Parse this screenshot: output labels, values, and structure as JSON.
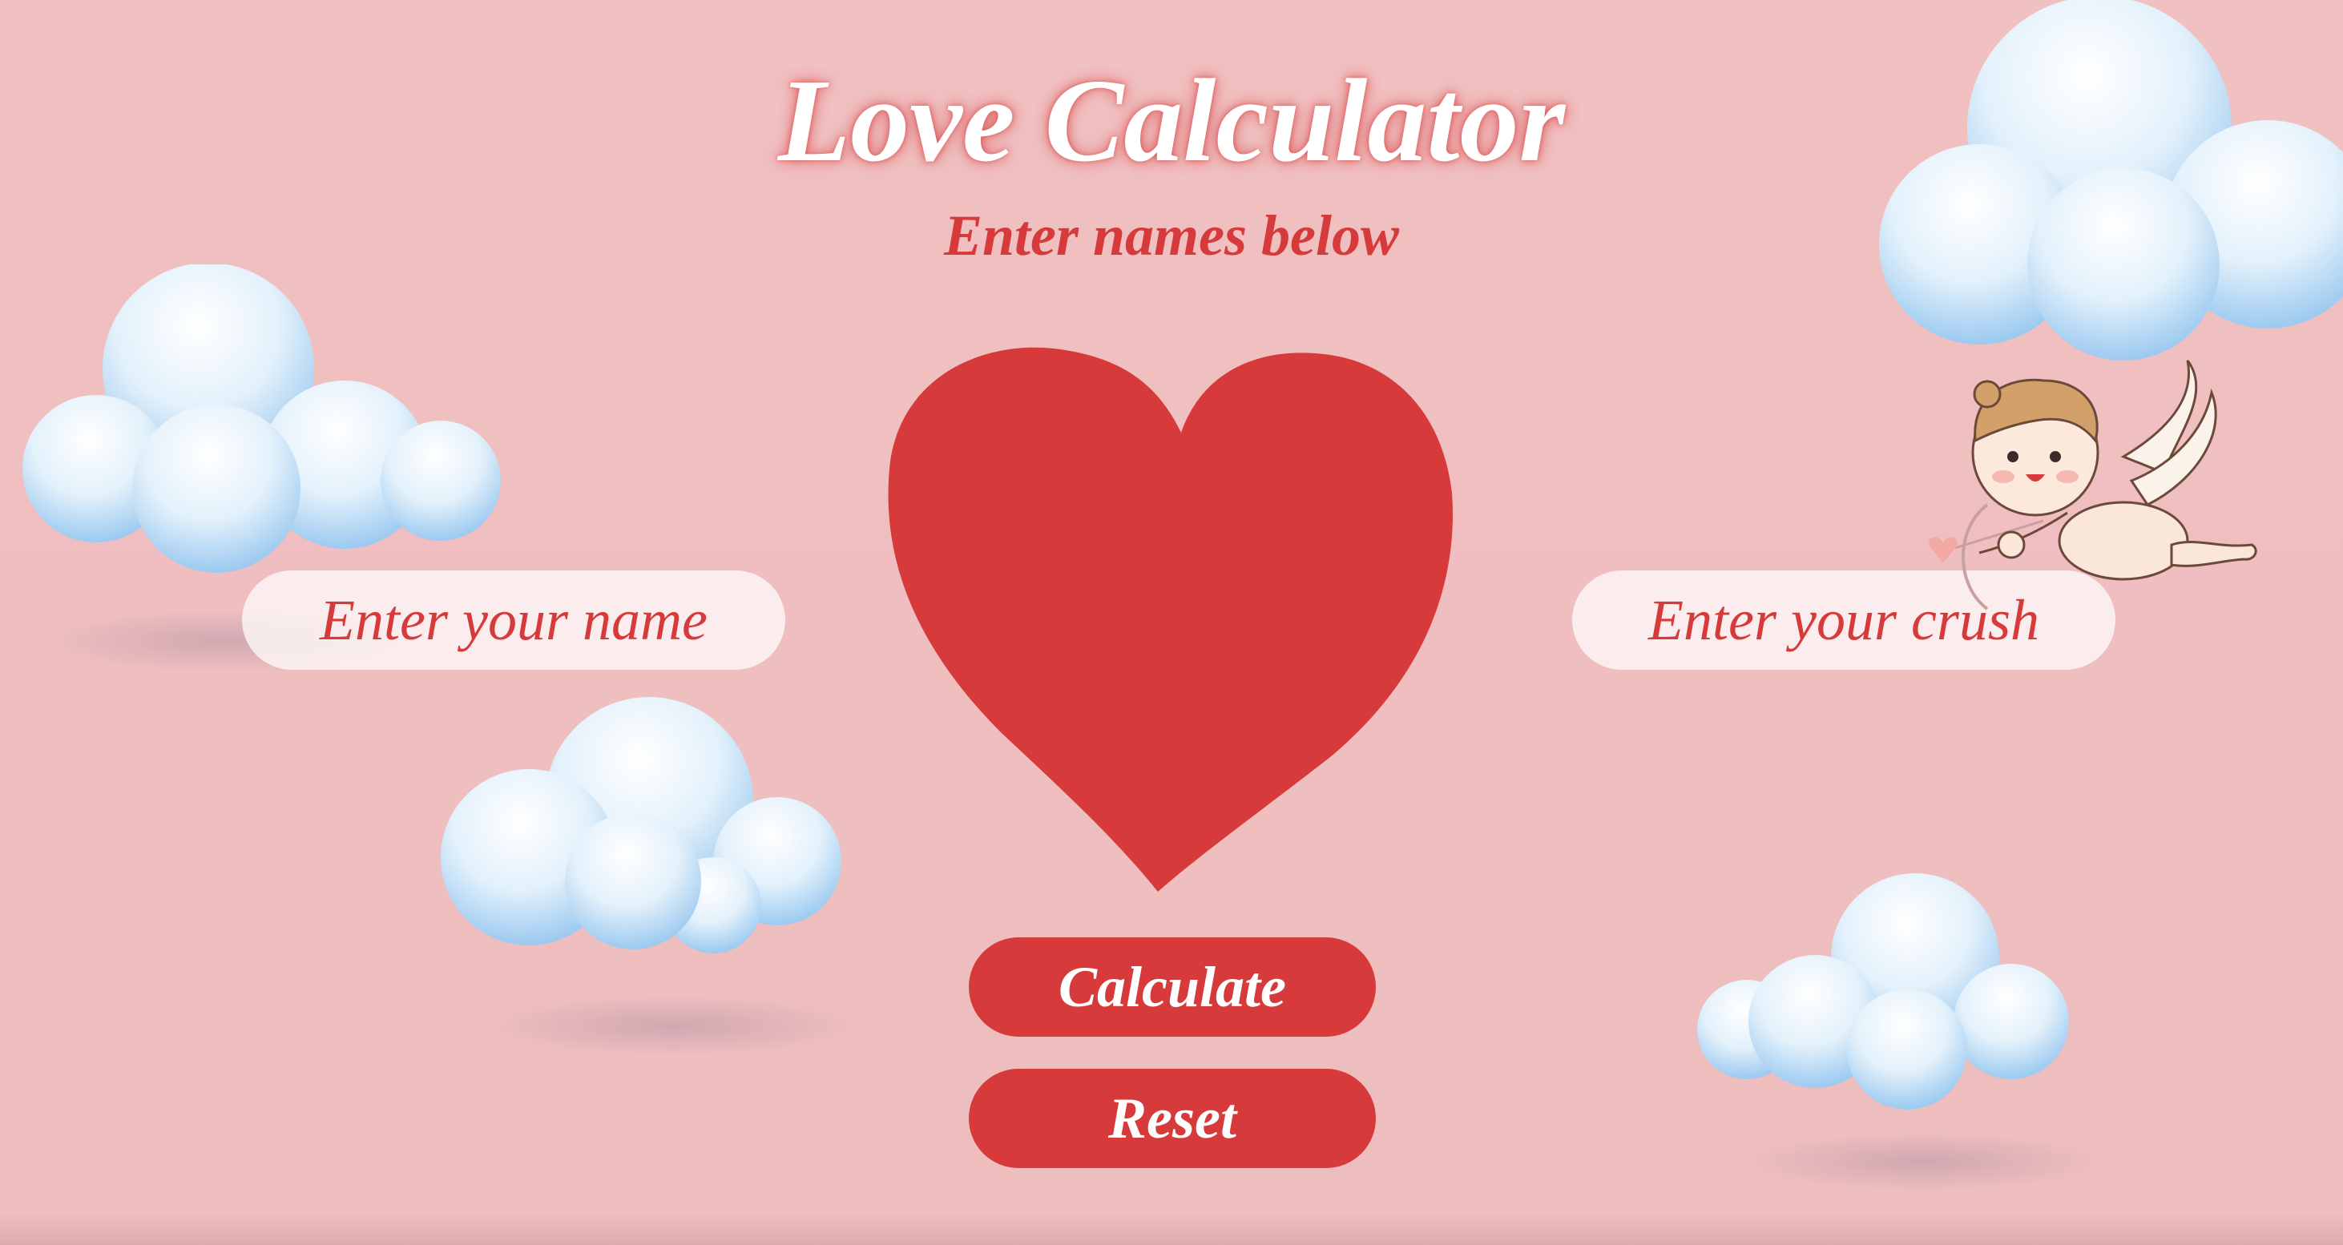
{
  "app": {
    "title": "Love Calculator",
    "subtitle": "Enter names below"
  },
  "inputs": {
    "name_placeholder": "Enter your name",
    "crush_placeholder": "Enter your crush"
  },
  "buttons": {
    "calculate_label": "Calculate",
    "reset_label": "Reset"
  },
  "colors": {
    "background": "#f0bfc0",
    "accent_red": "#d63a3a",
    "heart": "#d63a3a",
    "title_text": "#ffffff",
    "cloud": "#e6f3fb"
  },
  "icons": {
    "heart": "heart-icon",
    "cupid": "cupid-illustration",
    "clouds": "cloud-icon"
  }
}
